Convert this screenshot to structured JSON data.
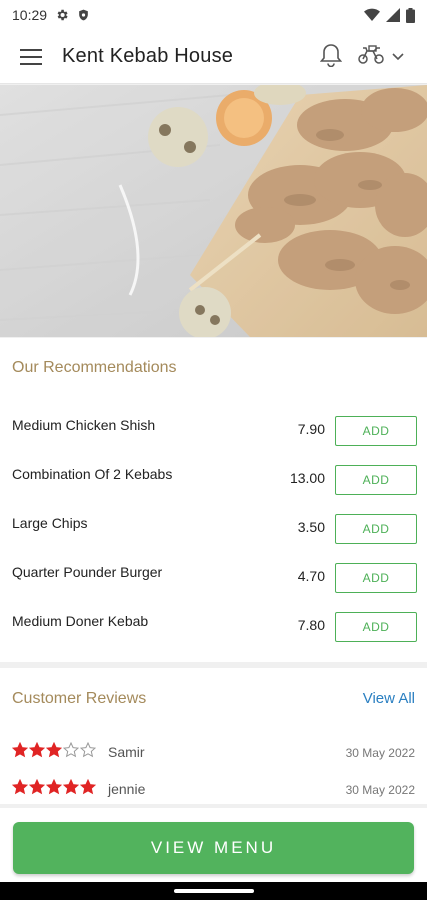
{
  "status_bar": {
    "time": "10:29",
    "left_icons": [
      "gear-icon",
      "shield-icon"
    ],
    "right_icons": [
      "wifi-icon",
      "signal-icon",
      "battery-icon"
    ]
  },
  "app_bar": {
    "title": "Kent Kebab House",
    "icons": [
      "hamburger-menu-icon",
      "bell-icon",
      "delivery-bike-icon",
      "chevron-down-icon"
    ]
  },
  "hero": {
    "image": "kebab skewers on wooden board with grilled vegetables"
  },
  "recommendations": {
    "title": "Our Recommendations",
    "add_label": "ADD",
    "items": [
      {
        "name": "Medium Chicken Shish",
        "price": "7.90"
      },
      {
        "name": "Combination Of 2 Kebabs",
        "price": "13.00"
      },
      {
        "name": "Large Chips",
        "price": "3.50"
      },
      {
        "name": "Quarter Pounder Burger",
        "price": "4.70"
      },
      {
        "name": "Medium Doner Kebab",
        "price": "7.80"
      }
    ]
  },
  "reviews": {
    "title": "Customer Reviews",
    "view_all": "View All",
    "items": [
      {
        "name": "Samir",
        "date": "30 May 2022",
        "rating": 3,
        "max": 5
      },
      {
        "name": "jennie",
        "date": "30 May 2022",
        "rating": 5,
        "max": 5
      }
    ]
  },
  "view_menu": {
    "label": "VIEW MENU"
  },
  "colors": {
    "accent_green": "#52b35d",
    "section_title_gold": "#a48a5b",
    "link_blue": "#2a7fc1",
    "star_red": "#e02424"
  }
}
